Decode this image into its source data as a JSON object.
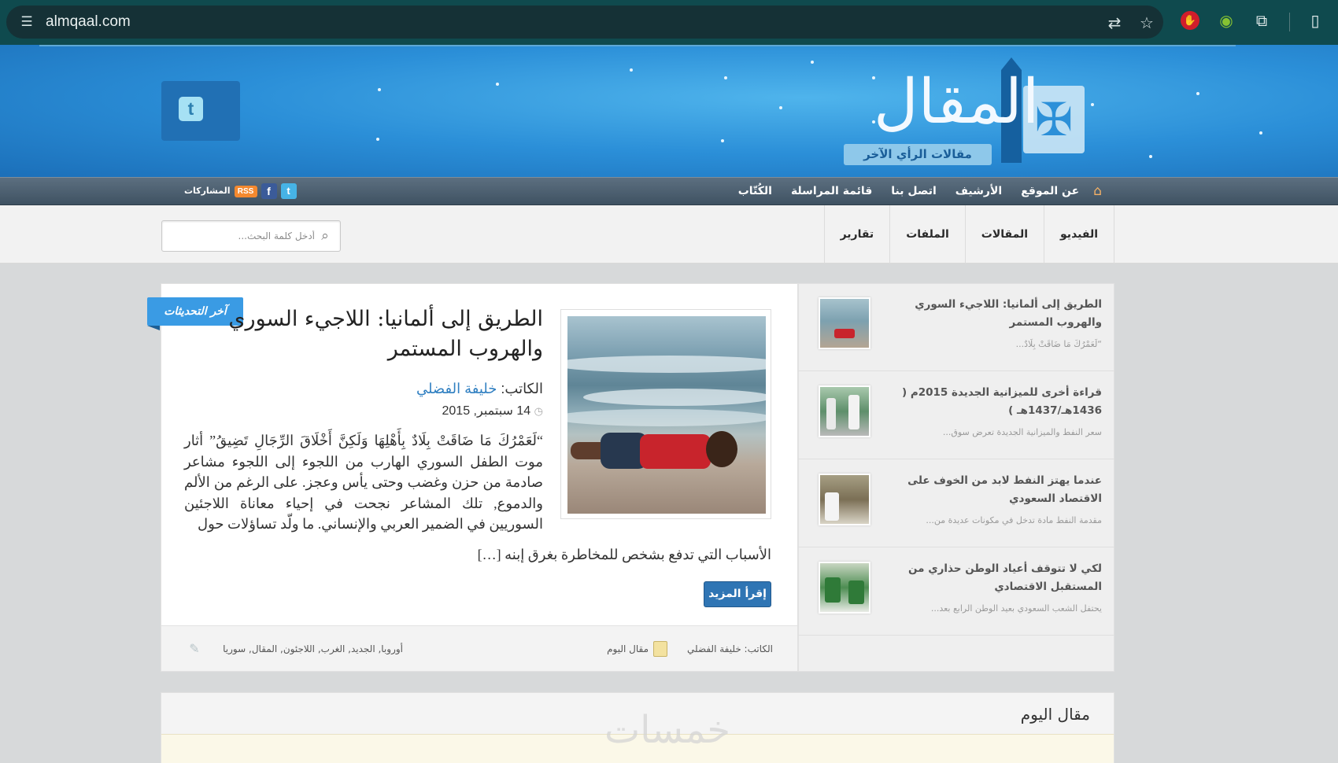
{
  "browser": {
    "url": "almqaal.com"
  },
  "banner": {
    "logo_text": "المقال",
    "logo_subtitle": "مقالات الرأي الآخر",
    "brand_color": "#2b8fd8"
  },
  "nav": {
    "home": "عن الموقع",
    "archive": "الأرشيف",
    "contact": "اتصل بنا",
    "mailing": "قائمة المراسلة",
    "writers": "الكُتّاب",
    "subscriptions": "المشاركات",
    "rss": "RSS"
  },
  "subnav": {
    "items": [
      "الفيديو",
      "المقالات",
      "الملفات",
      "تقارير"
    ],
    "search_placeholder": "أدخل كلمة البحث..."
  },
  "featured": {
    "ribbon": "آخر التحديثات",
    "title": "الطريق إلى ألمانيا: اللاجيء السوري والهروب المستمر",
    "byline_label": "الكاتب:",
    "author": "خليفة الفضلي",
    "date": "14 سبتمبر, 2015",
    "excerpt": "“لَعَمْرُكَ مَا ضَاقَتْ بِلَادٌ بِأَهْلِهَا وَلَكِنَّ أَخْلَاقَ الرِّجَالِ تَضِيقُ” أثار موت الطفل السوري الهارب من اللجوء إلى اللجوء مشاعر صادمة من حزن وغضب وحتى يأس وعجز. على الرغم من الألم والدموع, تلك المشاعر نجحت في إحياء معاناة اللاجئين السوريين في الضمير العربي والإنساني. ما ولّد تساؤلات حول",
    "excerpt_tail": "الأسباب التي تدفع بشخص للمخاطرة بغرق إبنه […]",
    "read_more": "إقرأ المزيد",
    "meta_author": "الكاتب: خليفة الفضلي",
    "meta_category": "مقال اليوم",
    "meta_tags": "أوروبا, الجديد, الغرب, اللاجئون, المقال, سوريا"
  },
  "sidebar": {
    "items": [
      {
        "title": "الطريق إلى ألمانيا: اللاجيء السوري والهروب المستمر",
        "excerpt": "“لَعَمْرُكَ مَا ضَاقَتْ بِلَادٌ..."
      },
      {
        "title": "قراءة أخرى للميزانية الجديدة 2015م ( 1436هـ/1437هـ )",
        "excerpt": "سعر النفط والميزانية الجديدة تعرض سوق..."
      },
      {
        "title": "عندما يهتز النفط لابد من الخوف على الاقتصاد السعودي",
        "excerpt": "مقدمة النفط مادة تدخل في مكونات عديدة من..."
      },
      {
        "title": "لكي لا تتوقف أعياد الوطن حذاري من المستقبل الاقتصادي",
        "excerpt": "يحتفل الشعب السعودي بعيد الوطن الرابع بعد..."
      }
    ]
  },
  "lower": {
    "title": "مقال اليوم",
    "watermark": "خمسات"
  }
}
